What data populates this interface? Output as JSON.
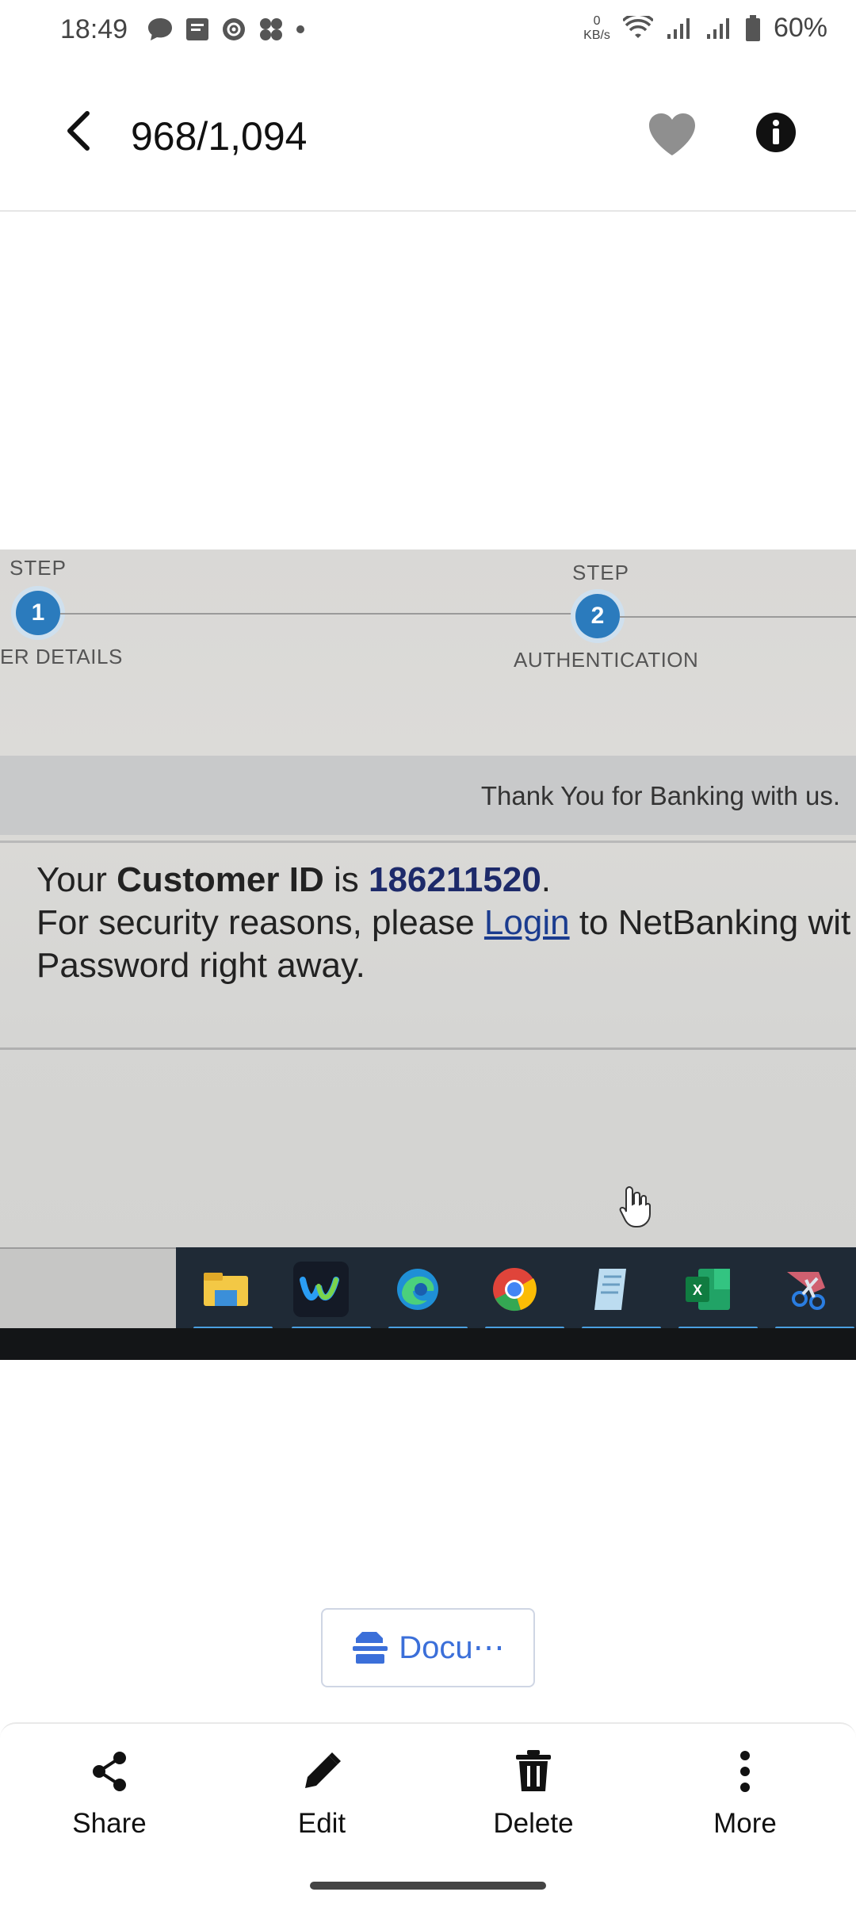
{
  "status_bar": {
    "time": "18:49",
    "net_speed_value": "0",
    "net_speed_unit": "KB/s",
    "battery": "60%",
    "icons": [
      "chat-icon",
      "note-icon",
      "vpn-icon",
      "fan-icon",
      "dot-icon",
      "wifi-icon",
      "signal-icon",
      "signal-icon",
      "battery-icon"
    ]
  },
  "app_bar": {
    "counter": "968/1,094",
    "back_icon": "back-arrow-icon",
    "favorite_icon": "heart-icon",
    "info_icon": "info-icon"
  },
  "photo": {
    "steps": [
      {
        "label": "STEP",
        "number": "1",
        "caption": "ER DETAILS"
      },
      {
        "label": "STEP",
        "number": "2",
        "caption": "AUTHENTICATION"
      }
    ],
    "thank_you": "Thank You for Banking with us.",
    "message": {
      "your": "Your",
      "customer_id_label": "Customer ID",
      "is": "is",
      "customer_id": "186211520",
      "period": ".",
      "line2_prefix": "For security reasons, please",
      "login_link": "Login",
      "line2_suffix": "to NetBanking wit",
      "line3": "Password right away."
    },
    "taskbar_apps": [
      "file-explorer-icon",
      "webex-icon",
      "edge-icon",
      "chrome-icon",
      "notepad-icon",
      "excel-icon",
      "snipping-tool-icon"
    ]
  },
  "document_chip": {
    "label": "Docu⋯",
    "icon": "document-icon"
  },
  "actions": [
    {
      "label": "Share",
      "icon": "share-icon"
    },
    {
      "label": "Edit",
      "icon": "pencil-icon"
    },
    {
      "label": "Delete",
      "icon": "trash-icon"
    },
    {
      "label": "More",
      "icon": "more-vertical-icon"
    }
  ]
}
